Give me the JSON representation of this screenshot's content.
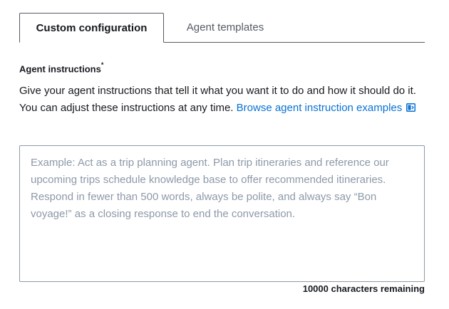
{
  "tabs": [
    {
      "label": "Custom configuration",
      "active": true
    },
    {
      "label": "Agent templates",
      "active": false
    }
  ],
  "field": {
    "label": "Agent instructions",
    "required_marker": "*",
    "description": "Give your agent instructions that tell it what you want it to do and how it should do it. You can adjust these instructions at any time.",
    "link_label": "Browse agent instruction examples",
    "link_icon": "external-link-icon",
    "placeholder": "Example: Act as a trip planning agent. Plan trip itineraries and reference our upcoming trips schedule knowledge base to offer recommended itineraries. Respond in fewer than 500 words, always be polite, and always say “Bon voyage!” as a closing response to end the conversation.",
    "value": "",
    "counter": "10000 characters remaining"
  },
  "colors": {
    "link": "#0972d3",
    "text": "#16191f",
    "muted": "#545b64",
    "placeholder": "#8d99a8"
  }
}
